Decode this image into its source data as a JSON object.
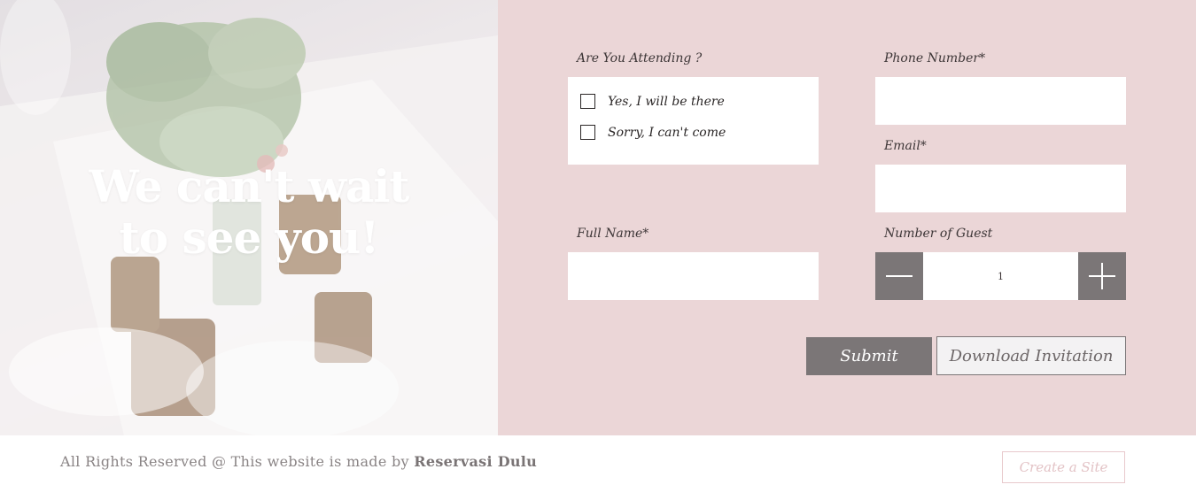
{
  "hero": {
    "title_line1": "We can't wait",
    "title_line2": "to see you!"
  },
  "form": {
    "attending_label": "Are You Attending ?",
    "attending_options": [
      {
        "label": "Yes, I will be there",
        "checked": false
      },
      {
        "label": "Sorry, I can't come",
        "checked": false
      }
    ],
    "phone_label": "Phone Number*",
    "phone_value": "",
    "email_label": "Email*",
    "email_value": "",
    "fullname_label": "Full Name*",
    "fullname_value": "",
    "guests_label": "Number of Guest",
    "guests_value": "1",
    "decrement_icon": "minus-icon",
    "increment_icon": "plus-icon",
    "submit_label": "Submit",
    "download_label": "Download Invitation"
  },
  "footer": {
    "copyright_prefix": "All Rights Reserved @ This website is made by ",
    "brand": "Reservasi Dulu",
    "create_site_label": "Create a Site"
  },
  "colors": {
    "form_bg": "#ebd6d7",
    "button_gray": "#7b7677",
    "footer_pink": "#e3c3c6"
  }
}
